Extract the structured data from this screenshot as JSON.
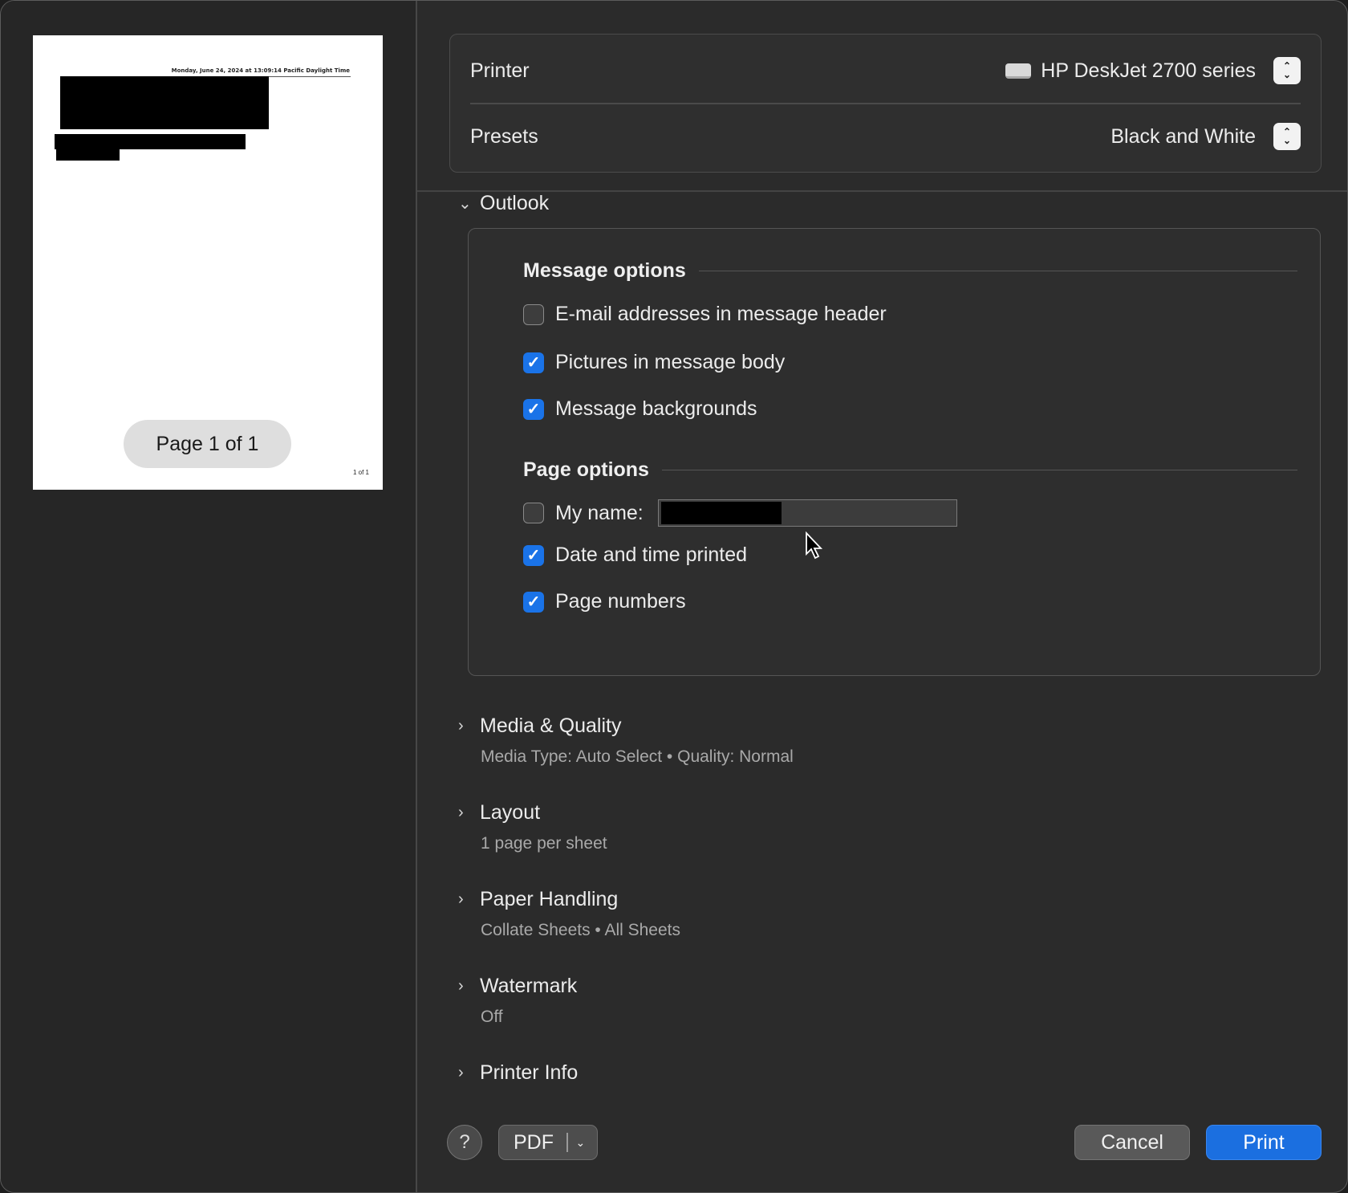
{
  "preview": {
    "header_text": "Monday, June 24, 2024 at 13:09:14 Pacific Daylight Time",
    "footer_text": "1 of 1",
    "page_indicator": "Page 1 of 1"
  },
  "printer": {
    "label": "Printer",
    "value": "HP DeskJet 2700 series",
    "icon": "printer-icon"
  },
  "presets": {
    "label": "Presets",
    "value": "Black and White"
  },
  "outlook": {
    "title": "Outlook",
    "expanded": true,
    "message_options": {
      "title": "Message options",
      "items": [
        {
          "label": "E-mail addresses in message header",
          "checked": false
        },
        {
          "label": "Pictures in message body",
          "checked": true
        },
        {
          "label": "Message backgrounds",
          "checked": true
        }
      ]
    },
    "page_options": {
      "title": "Page options",
      "my_name": {
        "label": "My name:",
        "checked": false
      },
      "items": [
        {
          "label": "Date and time printed",
          "checked": true
        },
        {
          "label": "Page numbers",
          "checked": true
        }
      ]
    }
  },
  "sections": [
    {
      "title": "Media & Quality",
      "summary": "Media Type: Auto Select • Quality: Normal"
    },
    {
      "title": "Layout",
      "summary": "1 page per sheet"
    },
    {
      "title": "Paper Handling",
      "summary": "Collate Sheets • All Sheets"
    },
    {
      "title": "Watermark",
      "summary": "Off"
    },
    {
      "title": "Printer Info",
      "summary": ""
    }
  ],
  "footer": {
    "help": "?",
    "pdf": "PDF",
    "cancel": "Cancel",
    "print": "Print"
  },
  "colors": {
    "accent": "#1a73e8",
    "dialog_bg": "#2b2b2b"
  }
}
